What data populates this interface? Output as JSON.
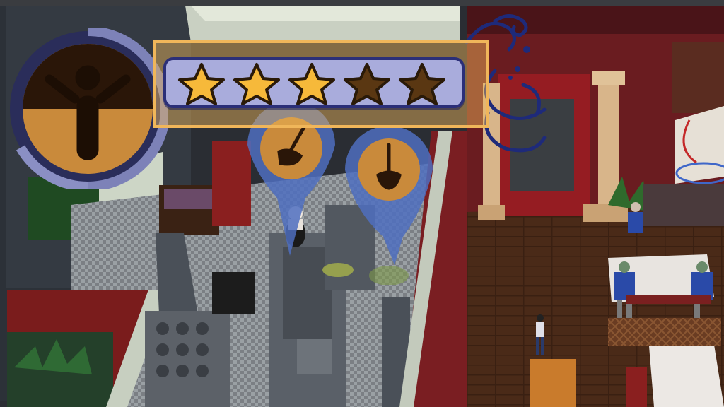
{
  "rating": {
    "stars_filled": 3,
    "stars_total": 5,
    "colors": {
      "filled": "#f6b93a",
      "empty": "#5a3712",
      "outline": "#2a1a08",
      "bar_fill": "#a9acdc",
      "bar_border": "#2b2f78",
      "frame": "#f0b65a"
    }
  },
  "status_dial": {
    "icon": "person-arms-raised-icon",
    "colors": {
      "ring": "#7d82b8",
      "ring_dark": "#2a2d5a",
      "top_fill": "#2a1608",
      "bottom_fill": "#c98a3b"
    }
  },
  "markers": [
    {
      "icon": "mop-icon"
    },
    {
      "icon": "mop-icon"
    }
  ]
}
